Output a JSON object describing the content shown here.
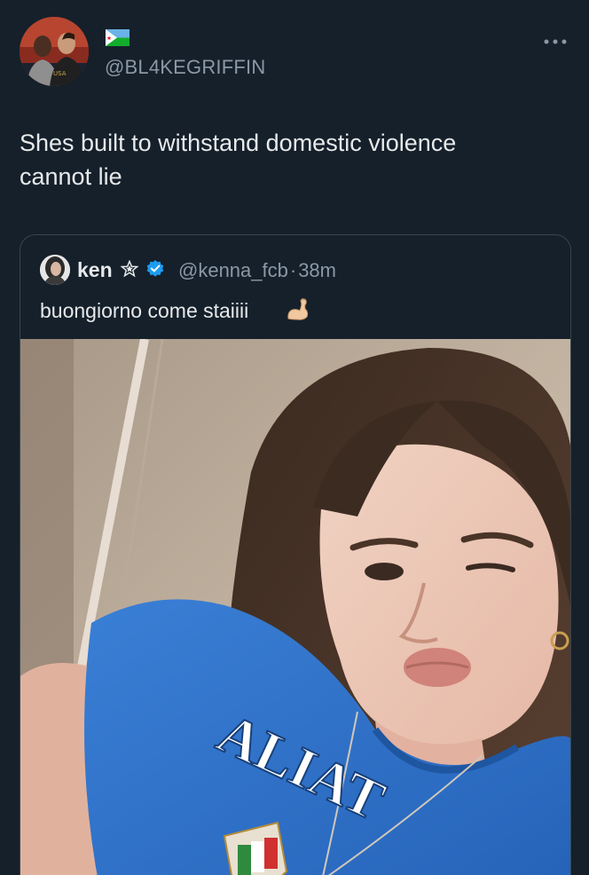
{
  "tweet": {
    "handle": "@BL4KEGRIFFIN",
    "avatar_icon": "two-men-avatar",
    "flag_icon": "djibouti-flag-icon",
    "more_icon": "more-options-icon",
    "text_line1": "Shes built to withstand domestic violence",
    "text_line2": "cannot lie"
  },
  "quote": {
    "name": "ken",
    "star_icon": "star-outline-icon",
    "verified_icon": "verified-badge-icon",
    "handle": "@kenna_fcb",
    "separator": "·",
    "time": "38m",
    "text": "buongiorno come staiiii",
    "emoji_icon": "flexed-biceps-emoji",
    "photo": {
      "shirt_text": "ALIAT",
      "shirt_color": "#2d6ec4"
    }
  },
  "colors": {
    "background": "#15202b",
    "text_primary": "#e7e9ea",
    "text_secondary": "#8b98a5",
    "verified_blue": "#1d9bf0",
    "border": "#38444d"
  }
}
